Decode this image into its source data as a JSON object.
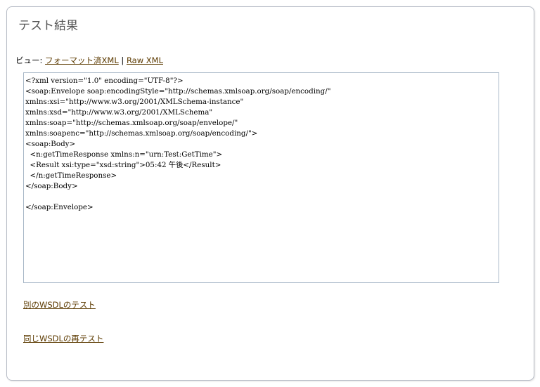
{
  "page": {
    "title": "テスト結果"
  },
  "view": {
    "label": "ビュー: ",
    "formatted_link": "フォーマット済XML",
    "separator": " | ",
    "raw_link": "Raw XML"
  },
  "xml_output": "<?xml version=\"1.0\" encoding=\"UTF-8\"?>\n<soap:Envelope soap:encodingStyle=\"http://schemas.xmlsoap.org/soap/encoding/\"\nxmlns:xsi=\"http://www.w3.org/2001/XMLSchema-instance\"\nxmlns:xsd=\"http://www.w3.org/2001/XMLSchema\"\nxmlns:soap=\"http://schemas.xmlsoap.org/soap/envelope/\"\nxmlns:soapenc=\"http://schemas.xmlsoap.org/soap/encoding/\">\n<soap:Body>\n  <n:getTimeResponse xmlns:n=\"urn:Test:GetTime\">\n  <Result xsi:type=\"xsd:string\">05:42 午後</Result>\n  </n:getTimeResponse>\n</soap:Body>\n\n</soap:Envelope>",
  "links": {
    "other_wsdl": "別のWSDLのテスト",
    "retest_same_wsdl": "同じWSDLの再テスト"
  },
  "colors": {
    "link": "#5c3a00",
    "title": "#555555",
    "panel_border": "#b7bcc6",
    "xml_box_border": "#a9b8c8"
  }
}
